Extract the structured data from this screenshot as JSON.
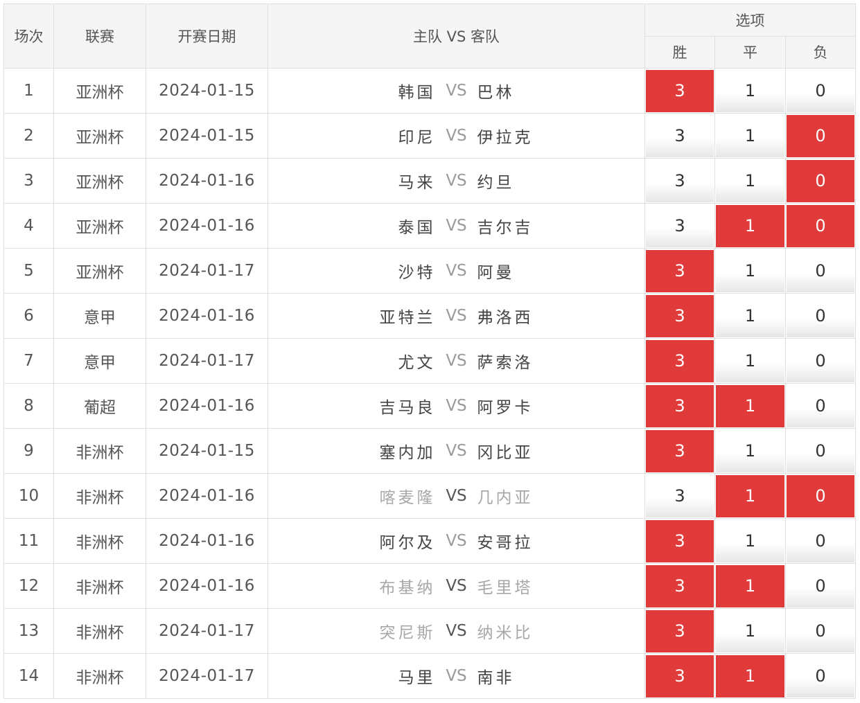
{
  "header": {
    "match_no": "场次",
    "league": "联赛",
    "date": "开赛日期",
    "teams": "主队 VS 客队",
    "options_group": "选项",
    "win": "胜",
    "draw": "平",
    "loss": "负"
  },
  "colors": {
    "selected": "#e03a3a",
    "header_bg": "#f5f5f5"
  },
  "rows": [
    {
      "no": "1",
      "league": "亚洲杯",
      "date": "2024-01-15",
      "home": "韩国",
      "vs": "VS",
      "away": "巴林",
      "dim": false,
      "win": "3",
      "draw": "1",
      "loss": "0",
      "sel": [
        true,
        false,
        false
      ]
    },
    {
      "no": "2",
      "league": "亚洲杯",
      "date": "2024-01-15",
      "home": "印尼",
      "vs": "VS",
      "away": "伊拉克",
      "dim": false,
      "win": "3",
      "draw": "1",
      "loss": "0",
      "sel": [
        false,
        false,
        true
      ]
    },
    {
      "no": "3",
      "league": "亚洲杯",
      "date": "2024-01-16",
      "home": "马来",
      "vs": "VS",
      "away": "约旦",
      "dim": false,
      "win": "3",
      "draw": "1",
      "loss": "0",
      "sel": [
        false,
        false,
        true
      ]
    },
    {
      "no": "4",
      "league": "亚洲杯",
      "date": "2024-01-16",
      "home": "泰国",
      "vs": "VS",
      "away": "吉尔吉",
      "dim": false,
      "win": "3",
      "draw": "1",
      "loss": "0",
      "sel": [
        false,
        true,
        true
      ]
    },
    {
      "no": "5",
      "league": "亚洲杯",
      "date": "2024-01-17",
      "home": "沙特",
      "vs": "VS",
      "away": "阿曼",
      "dim": false,
      "win": "3",
      "draw": "1",
      "loss": "0",
      "sel": [
        true,
        false,
        false
      ]
    },
    {
      "no": "6",
      "league": "意甲",
      "date": "2024-01-16",
      "home": "亚特兰",
      "vs": "VS",
      "away": "弗洛西",
      "dim": false,
      "win": "3",
      "draw": "1",
      "loss": "0",
      "sel": [
        true,
        false,
        false
      ]
    },
    {
      "no": "7",
      "league": "意甲",
      "date": "2024-01-17",
      "home": "尤文",
      "vs": "VS",
      "away": "萨索洛",
      "dim": false,
      "win": "3",
      "draw": "1",
      "loss": "0",
      "sel": [
        true,
        false,
        false
      ]
    },
    {
      "no": "8",
      "league": "葡超",
      "date": "2024-01-16",
      "home": "吉马良",
      "vs": "VS",
      "away": "阿罗卡",
      "dim": false,
      "win": "3",
      "draw": "1",
      "loss": "0",
      "sel": [
        true,
        true,
        false
      ]
    },
    {
      "no": "9",
      "league": "非洲杯",
      "date": "2024-01-15",
      "home": "塞内加",
      "vs": "VS",
      "away": "冈比亚",
      "dim": false,
      "win": "3",
      "draw": "1",
      "loss": "0",
      "sel": [
        true,
        false,
        false
      ]
    },
    {
      "no": "10",
      "league": "非洲杯",
      "date": "2024-01-16",
      "home": "喀麦隆",
      "vs": "VS",
      "away": "几内亚",
      "dim": true,
      "win": "3",
      "draw": "1",
      "loss": "0",
      "sel": [
        false,
        true,
        true
      ]
    },
    {
      "no": "11",
      "league": "非洲杯",
      "date": "2024-01-16",
      "home": "阿尔及",
      "vs": "VS",
      "away": "安哥拉",
      "dim": false,
      "win": "3",
      "draw": "1",
      "loss": "0",
      "sel": [
        true,
        false,
        false
      ]
    },
    {
      "no": "12",
      "league": "非洲杯",
      "date": "2024-01-16",
      "home": "布基纳",
      "vs": "VS",
      "away": "毛里塔",
      "dim": true,
      "win": "3",
      "draw": "1",
      "loss": "0",
      "sel": [
        true,
        true,
        false
      ]
    },
    {
      "no": "13",
      "league": "非洲杯",
      "date": "2024-01-17",
      "home": "突尼斯",
      "vs": "VS",
      "away": "纳米比",
      "dim": true,
      "win": "3",
      "draw": "1",
      "loss": "0",
      "sel": [
        true,
        false,
        false
      ]
    },
    {
      "no": "14",
      "league": "非洲杯",
      "date": "2024-01-17",
      "home": "马里",
      "vs": "VS",
      "away": "南非",
      "dim": false,
      "win": "3",
      "draw": "1",
      "loss": "0",
      "sel": [
        true,
        true,
        false
      ]
    }
  ]
}
